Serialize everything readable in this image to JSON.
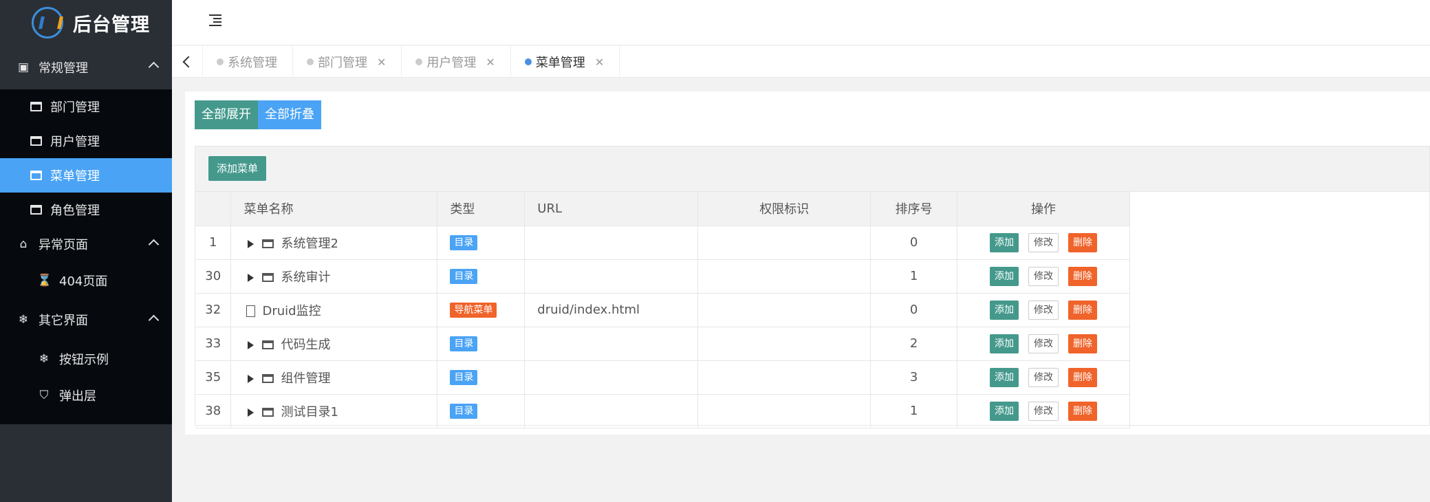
{
  "app": {
    "title": "后台管理"
  },
  "sidebar": {
    "groups": [
      {
        "label": "常规管理",
        "items": [
          {
            "label": "部门管理",
            "active": false
          },
          {
            "label": "用户管理",
            "active": false
          },
          {
            "label": "菜单管理",
            "active": true
          },
          {
            "label": "角色管理",
            "active": false
          }
        ]
      },
      {
        "label": "异常页面",
        "items": [
          {
            "label": "404页面"
          }
        ]
      },
      {
        "label": "其它界面",
        "items": [
          {
            "label": "按钮示例"
          },
          {
            "label": "弹出层"
          }
        ]
      }
    ]
  },
  "tabs": [
    {
      "label": "系统管理",
      "closable": false,
      "active": false
    },
    {
      "label": "部门管理",
      "closable": true,
      "active": false
    },
    {
      "label": "用户管理",
      "closable": true,
      "active": false
    },
    {
      "label": "菜单管理",
      "closable": true,
      "active": true
    }
  ],
  "toolbar": {
    "expand_all": "全部展开",
    "collapse_all": "全部折叠",
    "add_menu": "添加菜单"
  },
  "table": {
    "headers": {
      "name": "菜单名称",
      "type": "类型",
      "url": "URL",
      "perm": "权限标识",
      "sort": "排序号",
      "ops": "操作"
    },
    "ops": {
      "add": "添加",
      "edit": "修改",
      "delete": "删除"
    },
    "rows": [
      {
        "id": "1",
        "name": "系统管理2",
        "type": "目录",
        "url": "",
        "perm": "",
        "sort": "0"
      },
      {
        "id": "30",
        "name": "系统审计",
        "type": "目录",
        "url": "",
        "perm": "",
        "sort": "1"
      },
      {
        "id": "32",
        "name": "Druid监控",
        "type": "导航菜单",
        "url": "druid/index.html",
        "perm": "",
        "sort": "0"
      },
      {
        "id": "33",
        "name": "代码生成",
        "type": "目录",
        "url": "",
        "perm": "",
        "sort": "2"
      },
      {
        "id": "35",
        "name": "组件管理",
        "type": "目录",
        "url": "",
        "perm": "",
        "sort": "3"
      },
      {
        "id": "38",
        "name": "测试目录1",
        "type": "目录",
        "url": "",
        "perm": "",
        "sort": "1"
      }
    ]
  },
  "colors": {
    "accent_blue": "#4aa3f5",
    "teal": "#44998c",
    "danger": "#f0632a",
    "sidebar_dark": "#060a0f"
  }
}
